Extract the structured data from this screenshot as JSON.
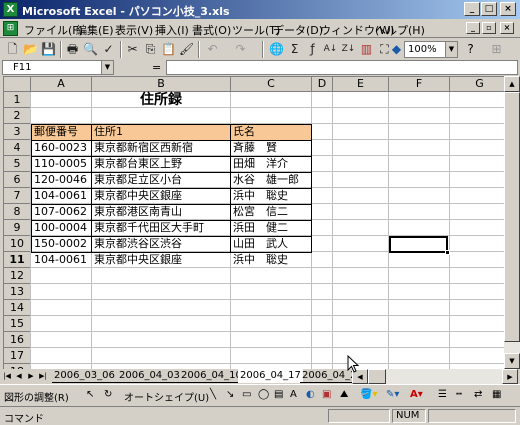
{
  "window": {
    "title": "Microsoft Excel - パソコン小技_3.xls",
    "app_icon": "X"
  },
  "menu": {
    "items": [
      "ファイル(F)",
      "編集(E)",
      "表示(V)",
      "挿入(I)",
      "書式(O)",
      "ツール(T)",
      "データ(D)",
      "ウィンドウ(W)",
      "ヘルプ(H)"
    ]
  },
  "toolbar": {
    "zoom": "100%"
  },
  "formula_bar": {
    "name_box": "F11",
    "equals": "=",
    "formula": ""
  },
  "sheet": {
    "columns": [
      "A",
      "B",
      "C",
      "D",
      "E",
      "F",
      "G"
    ],
    "rows": [
      "1",
      "2",
      "3",
      "4",
      "5",
      "6",
      "7",
      "8",
      "9",
      "10",
      "11",
      "12",
      "13",
      "14",
      "15",
      "16",
      "17",
      "18",
      "19"
    ],
    "title": "住所録",
    "headers": [
      "郵便番号",
      "住所1",
      "氏名"
    ],
    "records": [
      [
        "160-0023",
        "東京都新宿区西新宿",
        "斉藤　賢"
      ],
      [
        "110-0005",
        "東京都台東区上野",
        "田畑　洋介"
      ],
      [
        "120-0046",
        "東京都足立区小台",
        "水谷　雄一郎"
      ],
      [
        "104-0061",
        "東京都中央区銀座",
        "浜中　聡史"
      ],
      [
        "107-0062",
        "東京都港区南青山",
        "松宮　信二"
      ],
      [
        "100-0004",
        "東京都千代田区大手町",
        "浜田　健二"
      ],
      [
        "150-0002",
        "東京都渋谷区渋谷",
        "山田　武人"
      ],
      [
        "104-0061",
        "東京都中央区銀座",
        "浜中　聡史"
      ]
    ]
  },
  "sheet_tabs": {
    "tabs": [
      "2006_03_06",
      "2006_04_03",
      "2006_04_10",
      "2006_04_17",
      "2006_04_24"
    ],
    "active": "2006_04_17"
  },
  "draw_toolbar": {
    "shape_adjust": "図形の調整(R)",
    "autoshape": "オートシェイプ(U)"
  },
  "status": {
    "mode": "コマンド",
    "num": "NUM"
  },
  "colors": {
    "header_fill": "#f8c896",
    "titlebar_start": "#0a246a",
    "titlebar_end": "#a6caf0"
  }
}
